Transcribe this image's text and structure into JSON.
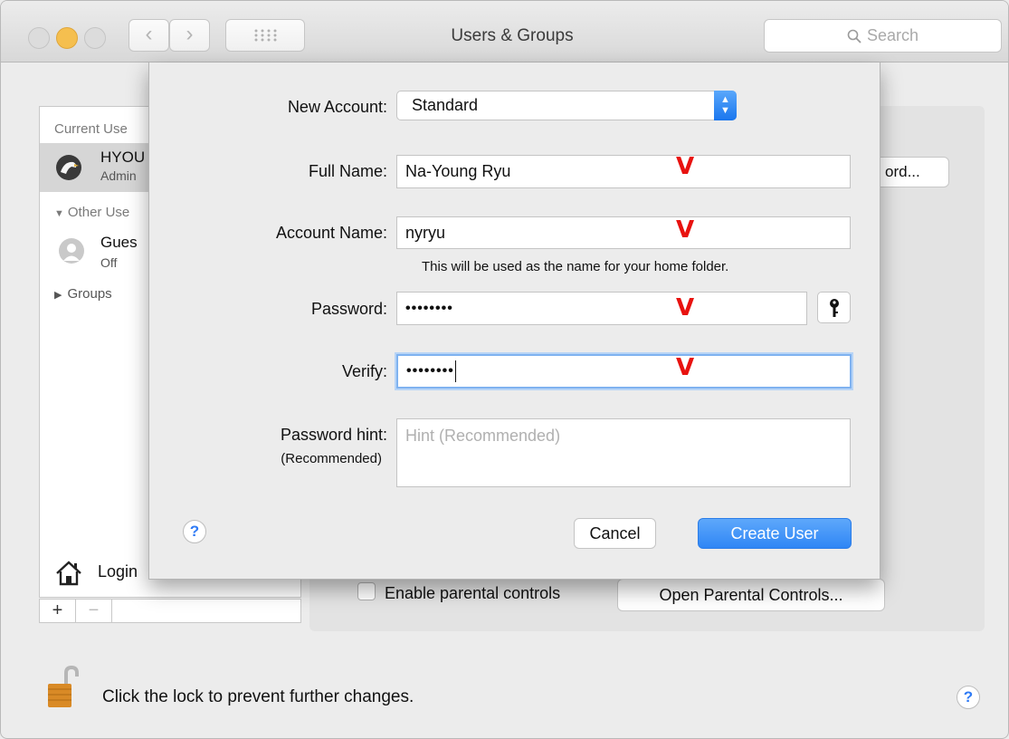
{
  "window": {
    "title": "Users & Groups",
    "search_placeholder": "Search"
  },
  "sidebar": {
    "current_header": "Current Use",
    "current_user": {
      "name": "HYOU",
      "role": "Admin"
    },
    "other_header": "Other Use",
    "guest": {
      "name": "Gues",
      "status": "Off"
    },
    "groups": "Groups",
    "login_label": "Login",
    "add": "+",
    "remove": "−"
  },
  "right_panel": {
    "password_button": "ord...",
    "parental_checkbox": "Enable parental controls",
    "parental_button": "Open Parental Controls..."
  },
  "footer": {
    "lock_text": "Click the lock to prevent further changes."
  },
  "sheet": {
    "new_account_label": "New Account:",
    "new_account_value": "Standard",
    "full_name_label": "Full Name:",
    "full_name_value": "Na-Young Ryu",
    "account_name_label": "Account Name:",
    "account_name_value": "nyryu",
    "account_note": "This will be used as the name for your home folder.",
    "password_label": "Password:",
    "password_value": "••••••••",
    "verify_label": "Verify:",
    "verify_value": "••••••••",
    "hint_label": "Password hint:",
    "hint_sub": "(Recommended)",
    "hint_placeholder": "Hint (Recommended)",
    "cancel": "Cancel",
    "create": "Create User",
    "help": "?",
    "check_mark": "V"
  },
  "colors": {
    "accent": "#2f86f5",
    "mark": "#e8120f"
  }
}
